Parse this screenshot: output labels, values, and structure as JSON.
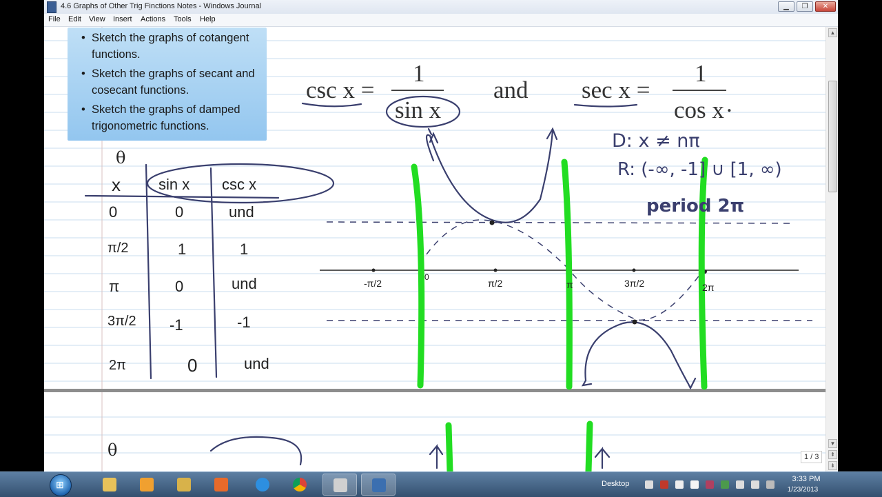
{
  "window": {
    "title": "4.6 Graphs of Other Trig Finctions  Notes - Windows Journal",
    "minimize_icon": "minimize-icon",
    "maximize_icon": "maximize-icon",
    "close_icon": "close-icon"
  },
  "menu": {
    "items": [
      "File",
      "Edit",
      "View",
      "Insert",
      "Actions",
      "Tools",
      "Help"
    ]
  },
  "objectives": [
    "Sketch the graphs of cotangent functions.",
    "Sketch the graphs of secant and cosecant functions.",
    "Sketch the graphs of damped trigonometric functions."
  ],
  "formula": {
    "csc_lhs": "csc x =",
    "csc_num": "1",
    "csc_den": "sin x",
    "and": "and",
    "sec_lhs": "sec x =",
    "sec_num": "1",
    "sec_den": "cos x",
    "period_mark": "."
  },
  "handwriting": {
    "domain": "D: x ≠ nπ",
    "range": "R: (-∞, -1] ∪ [1, ∞)",
    "period": "period 2π",
    "table_theta": "θ",
    "table_x": "x",
    "table_headers": [
      "sin x",
      "csc x"
    ],
    "table_rows": [
      {
        "x": "0",
        "sin": "0",
        "csc": "und"
      },
      {
        "x": "π/2",
        "sin": "1",
        "csc": "1"
      },
      {
        "x": "π",
        "sin": "0",
        "csc": "und"
      },
      {
        "x": "3π/2",
        "sin": "-1",
        "csc": "-1"
      },
      {
        "x": "2π",
        "sin": "0",
        "csc": "und"
      }
    ],
    "axis_labels": [
      "-π/2",
      "0",
      "π/2",
      "π",
      "3π/2",
      "2π"
    ]
  },
  "page_indicator": "1 / 3",
  "taskbar": {
    "desktop_label": "Desktop",
    "time": "3:33 PM",
    "date": "1/23/2013",
    "apps": [
      "explorer-icon",
      "media-icon",
      "security-icon",
      "player-icon",
      "ie-icon",
      "chrome-icon",
      "snip-icon",
      "journal-icon"
    ]
  },
  "colors": {
    "highlighter": "#22dd22",
    "ink": "#3a3f6e",
    "objectives_bg": "#a8d3f3"
  }
}
